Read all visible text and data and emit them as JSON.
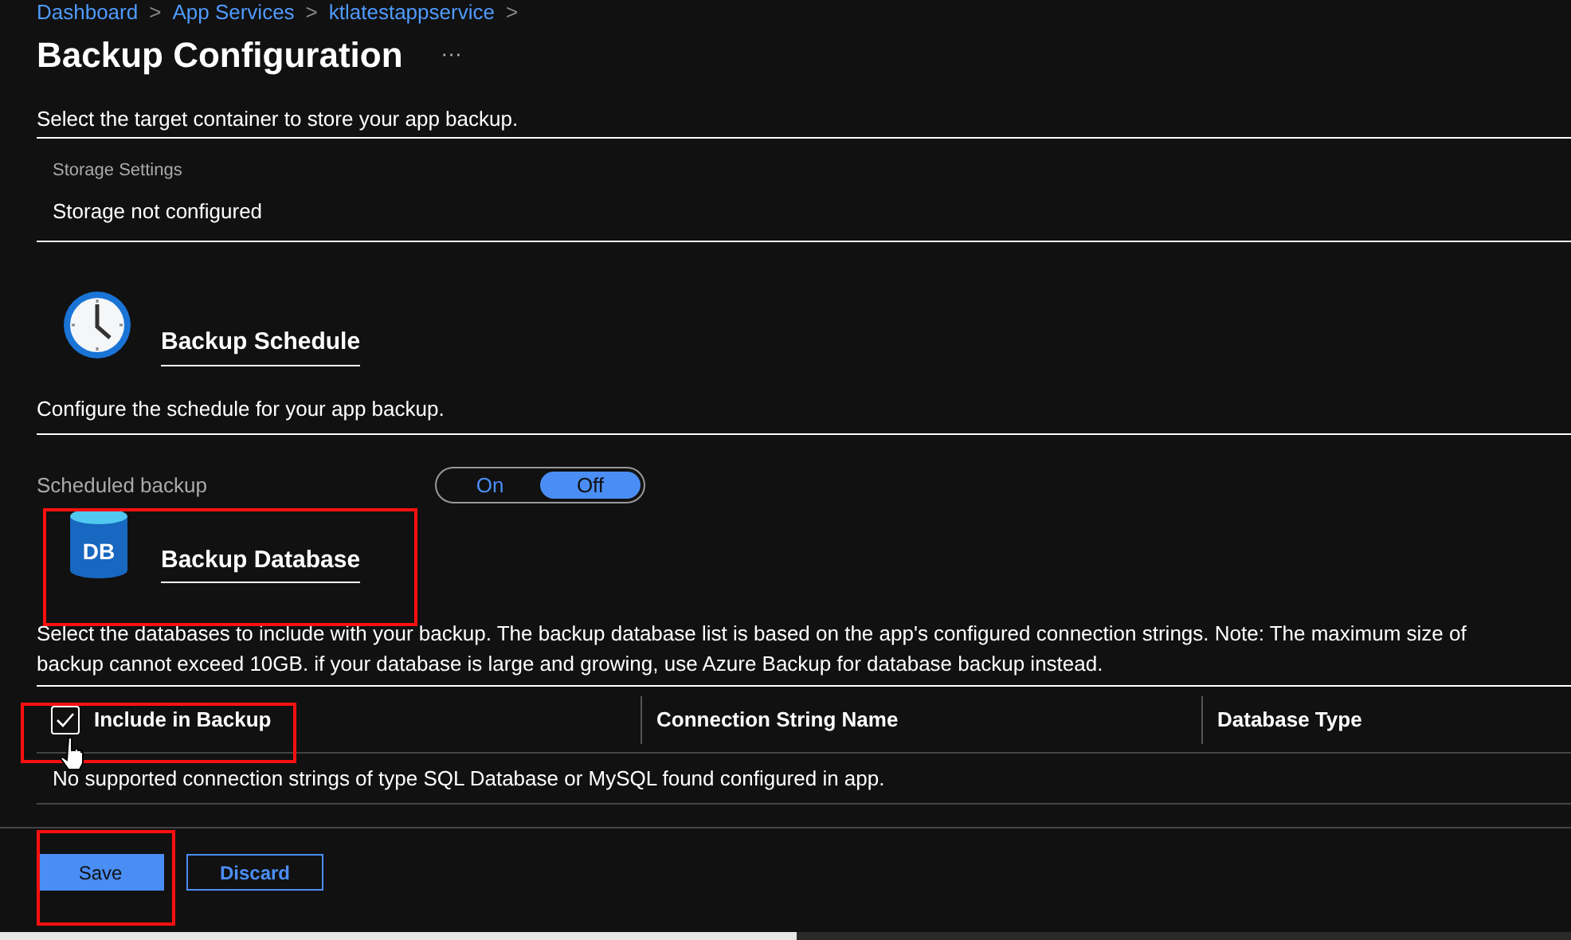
{
  "breadcrumb": [
    {
      "label": "Dashboard"
    },
    {
      "label": "App Services"
    },
    {
      "label": "ktlatestappservice"
    }
  ],
  "breadcrumb_separator": ">",
  "page": {
    "title": "Backup Configuration",
    "more": "···"
  },
  "storage": {
    "intro": "Select the target container to store your app backup.",
    "label": "Storage Settings",
    "value": "Storage not configured"
  },
  "schedule": {
    "title": "Backup Schedule",
    "description": "Configure the schedule for your app backup.",
    "label": "Scheduled backup",
    "toggle": [
      {
        "label": "On",
        "selected": false
      },
      {
        "label": "Off",
        "selected": true
      }
    ]
  },
  "database": {
    "title": "Backup Database",
    "icon_text": "DB",
    "description_lines": [
      "Select the databases to include with your backup. The backup database list is based on the app's configured connection strings. Note: The maximum size of",
      "backup cannot exceed 10GB. if your database is large and growing, use Azure Backup for database backup instead."
    ],
    "table": {
      "select_all_checked": true,
      "columns": [
        "Include in Backup",
        "Connection String Name",
        "Database Type"
      ],
      "empty_message": "No supported connection strings of type SQL Database or MySQL found configured in app."
    }
  },
  "buttons": [
    {
      "label": "Save",
      "kind": "primary"
    },
    {
      "label": "Discard",
      "kind": "secondary"
    }
  ]
}
